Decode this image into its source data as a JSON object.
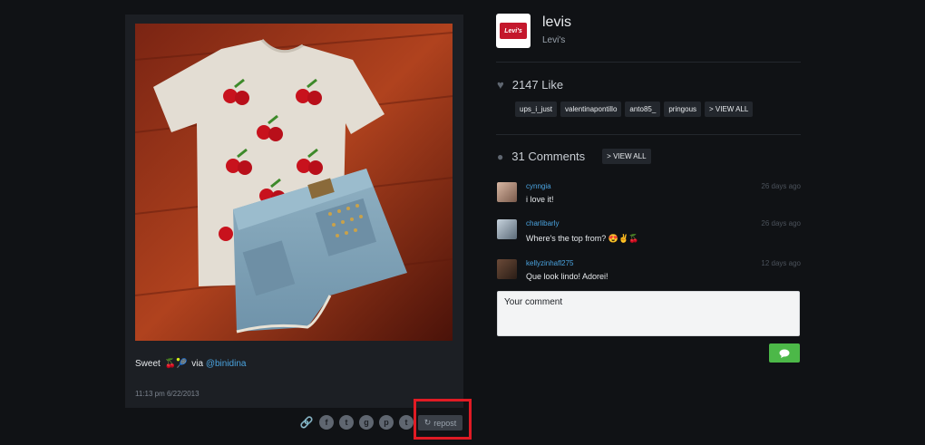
{
  "post": {
    "caption_text": "Sweet",
    "caption_emoji": "🍒🎾",
    "caption_via": "via",
    "caption_mention": "@binidina",
    "timestamp": "11:13 pm 6/22/2013"
  },
  "share": {
    "repost_label": "repost",
    "icons": [
      "link-icon",
      "facebook-icon",
      "twitter-icon",
      "google-plus-icon",
      "pinterest-icon",
      "tumblr-icon"
    ]
  },
  "brand": {
    "logo_text": "Levi's",
    "username": "levis",
    "display_name": "Levi's"
  },
  "likes": {
    "count_label": "2147 Like",
    "tags": [
      "ups_i_just",
      "valentinapontillo",
      "anto85_",
      "pringous",
      "> VIEW ALL"
    ]
  },
  "comments": {
    "count_label": "31 Comments",
    "view_all_label": "> VIEW ALL",
    "items": [
      {
        "user": "cynngia",
        "text": "i love it!",
        "time": "26 days ago"
      },
      {
        "user": "charlibarly",
        "text": "Where's the top from? 😍✌🍒",
        "time": "26 days ago"
      },
      {
        "user": "kellyzinhafl275",
        "text": "Que look lindo! Adorei!",
        "time": "12 days ago"
      }
    ],
    "input_placeholder": "Your comment"
  },
  "colors": {
    "accent_link": "#4aa3df",
    "send_green": "#4cb848",
    "highlight_red": "#e01b24"
  }
}
